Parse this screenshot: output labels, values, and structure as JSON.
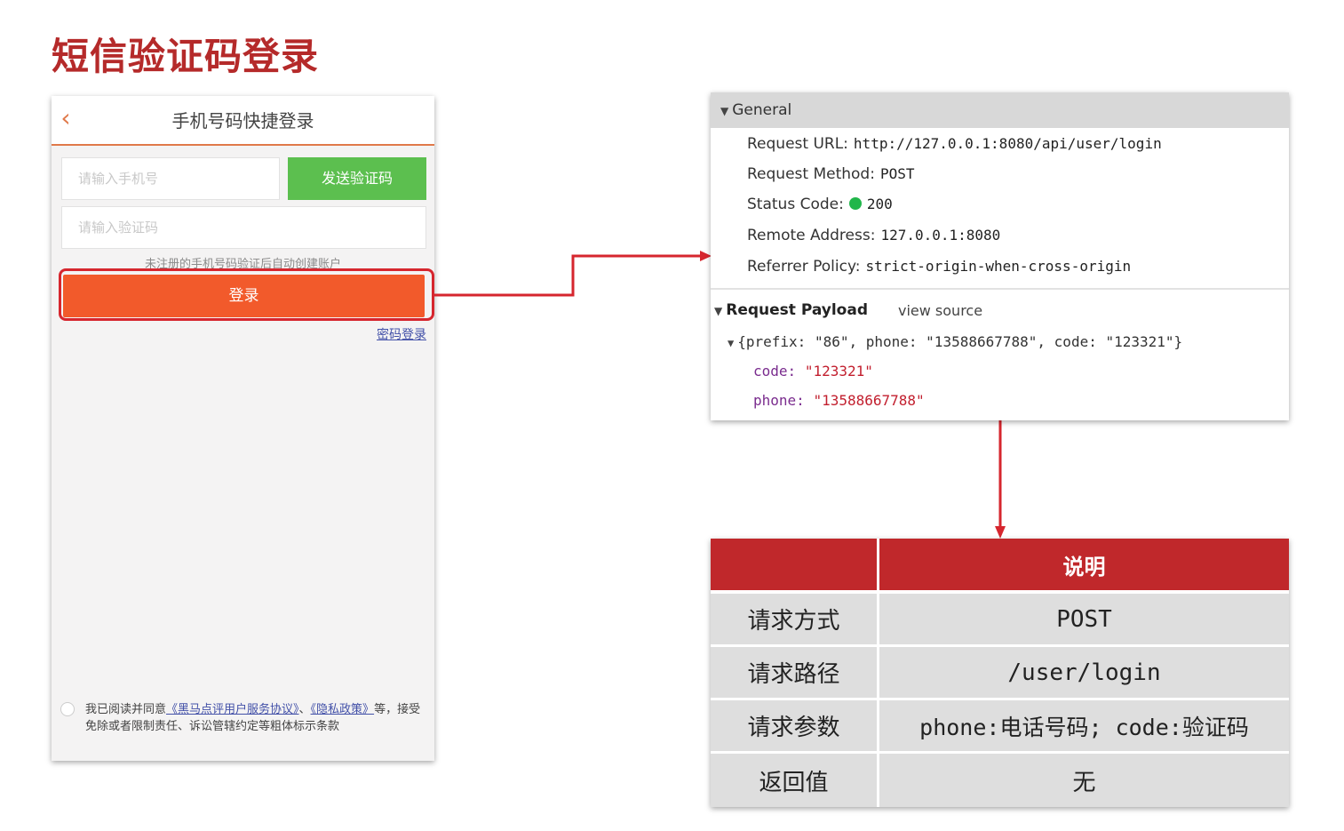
{
  "slide": {
    "title": "短信验证码登录"
  },
  "phone": {
    "back_icon": "chevron-left-icon",
    "title": "手机号码快捷登录",
    "phone_placeholder": "请输入手机号",
    "send_code_label": "发送验证码",
    "code_placeholder": "请输入验证码",
    "hint": "未注册的手机号码验证后自动创建账户",
    "login_label": "登录",
    "password_login_link": "密码登录",
    "agreement": {
      "prefix": "我已阅读并同意",
      "link1": "《黑马点评用户服务协议》",
      "sep": "、",
      "link2": "《隐私政策》",
      "suffix": "等，接受免除或者限制责任、诉讼管辖约定等粗体标示条款"
    },
    "accent_color": "#f25a2b",
    "send_color": "#5cbf4f"
  },
  "devtools": {
    "general_label": "General",
    "rows": [
      {
        "key": "Request URL:",
        "value": "http://127.0.0.1:8080/api/user/login"
      },
      {
        "key": "Request Method:",
        "value": "POST"
      },
      {
        "key": "Status Code:",
        "value": "200"
      },
      {
        "key": "Remote Address:",
        "value": "127.0.0.1:8080"
      },
      {
        "key": "Referrer Policy:",
        "value": "strict-origin-when-cross-origin"
      }
    ],
    "payload_label": "Request Payload",
    "view_source": "view source",
    "payload_summary_open": "{",
    "payload_summary": {
      "prefix_key": "prefix",
      "prefix_val": "\"86\"",
      "phone_key": "phone",
      "phone_val": "\"13588667788\"",
      "code_key": "code",
      "code_val": "\"123321\""
    },
    "payload_fields": [
      {
        "key": "code",
        "value": "\"123321\""
      },
      {
        "key": "phone",
        "value": "\"13588667788\""
      }
    ],
    "status_color": "#21b64a"
  },
  "info_table": {
    "header": [
      "",
      "说明"
    ],
    "rows": [
      {
        "label": "请求方式",
        "value": "POST"
      },
      {
        "label": "请求路径",
        "value": "/user/login"
      },
      {
        "label": "请求参数",
        "value": "phone:电话号码; code:验证码"
      },
      {
        "label": "返回值",
        "value": "无"
      }
    ],
    "header_color": "#c0282b"
  }
}
